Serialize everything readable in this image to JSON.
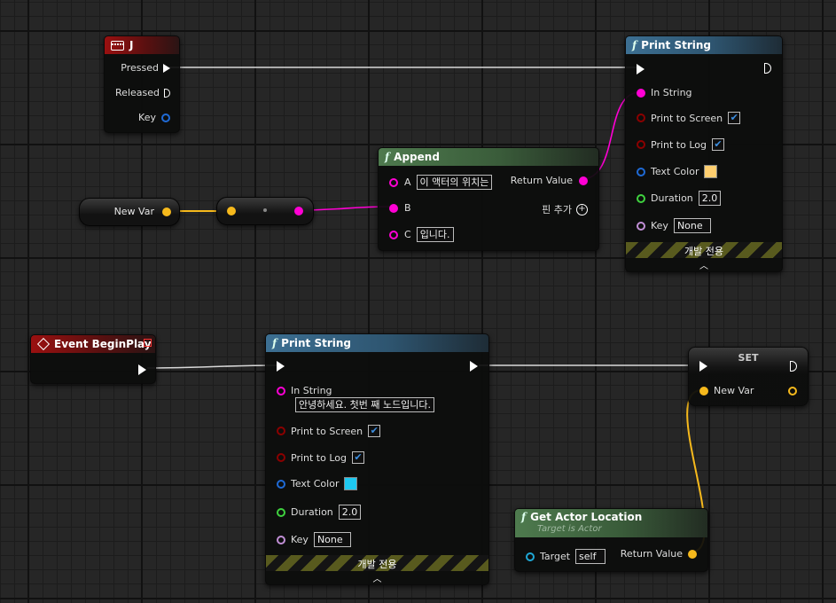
{
  "colors": {
    "exec": "#ffffff",
    "string": "#ff00d4",
    "vector": "#f6b91c",
    "boolean": "#8b0000",
    "linear_color": "#1f6ad6",
    "float": "#3fd23f",
    "key": "#1f6ad6",
    "object": "#1fa8d6",
    "name": "#c18fd6"
  },
  "nodes": {
    "input_j": {
      "title": "J",
      "icon": "keyboard-icon",
      "pins": {
        "pressed": "Pressed",
        "released": "Released",
        "key": "Key"
      }
    },
    "append": {
      "title": "Append",
      "pins": {
        "a": "A",
        "a_value": "이 액터의 위치는",
        "b": "B",
        "c": "C",
        "c_value": "입니다.",
        "return": "Return Value",
        "add_pin": "핀 추가"
      }
    },
    "print_top": {
      "title": "Print String",
      "pins": {
        "in_string": "In String",
        "print_screen": "Print to Screen",
        "print_log": "Print to Log",
        "text_color": "Text Color",
        "text_color_value": "#ffcf70",
        "duration": "Duration",
        "duration_value": "2.0",
        "key": "Key",
        "key_value": "None"
      },
      "dev_only": "개발 전용"
    },
    "new_var_get": {
      "label": "New Var"
    },
    "begin_play": {
      "title": "Event BeginPlay"
    },
    "print_bottom": {
      "title": "Print String",
      "pins": {
        "in_string": "In String",
        "in_string_value": "안녕하세요. 첫번 째 노드입니다.",
        "print_screen": "Print to Screen",
        "print_log": "Print to Log",
        "text_color": "Text Color",
        "text_color_value": "#1ec8f0",
        "duration": "Duration",
        "duration_value": "2.0",
        "key": "Key",
        "key_value": "None"
      },
      "dev_only": "개발 전용"
    },
    "set": {
      "title": "SET",
      "pins": {
        "new_var": "New Var"
      }
    },
    "get_actor_location": {
      "title": "Get Actor Location",
      "subtitle": "Target is Actor",
      "pins": {
        "target": "Target",
        "target_value": "self",
        "return": "Return Value"
      }
    }
  }
}
